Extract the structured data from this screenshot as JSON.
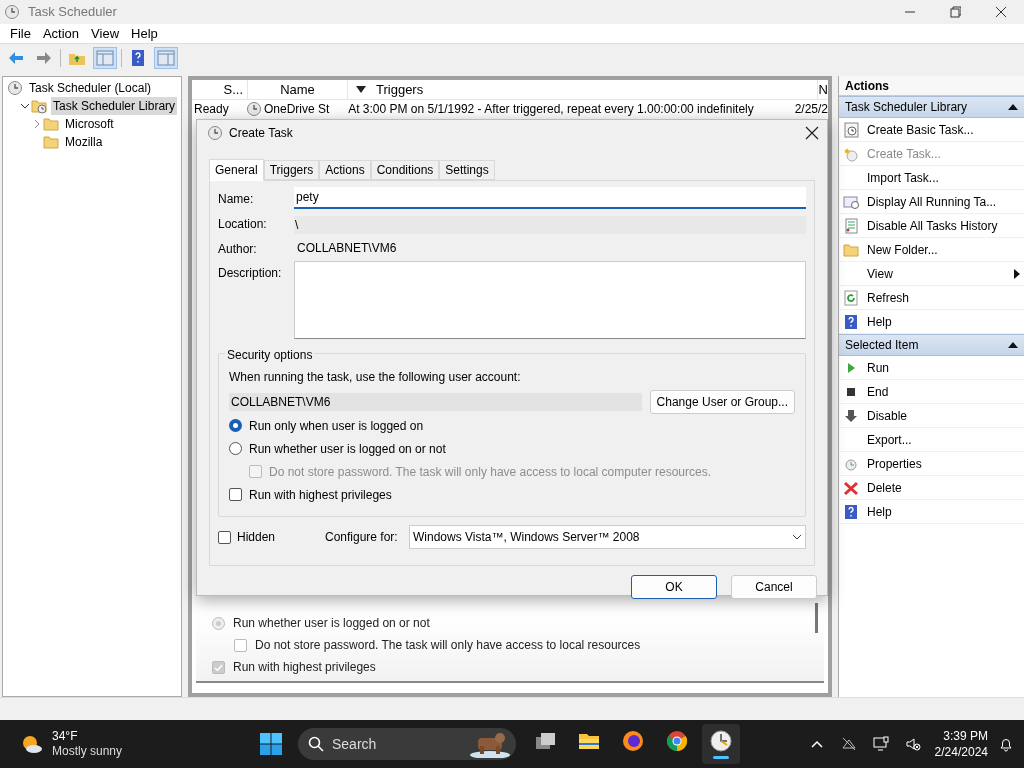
{
  "window": {
    "title": "Task Scheduler"
  },
  "menu": [
    "File",
    "Action",
    "View",
    "Help"
  ],
  "tree": [
    {
      "label": "Task Scheduler (Local)",
      "selected": false,
      "children": [
        {
          "label": "Task Scheduler Library",
          "selected": true,
          "expanded": true,
          "children": [
            {
              "label": "Microsoft",
              "selected": false,
              "expanded": false
            },
            {
              "label": "Mozilla",
              "selected": false
            }
          ]
        }
      ]
    }
  ],
  "task_list": {
    "columns": [
      "S...",
      "Name",
      "Triggers",
      "N"
    ],
    "rows": [
      [
        "Ready",
        "OneDrive St",
        "At 3:00 PM on 5/1/1992 - After triggered, repeat every 1.00:00:00 indefinitely",
        "2/25/2"
      ]
    ]
  },
  "background_properties": [
    {
      "kind": "radio",
      "label": "Run whether user is logged on or not",
      "checked": false
    },
    {
      "kind": "checkbox",
      "label": "Do not store password.  The task will only have access to local resources",
      "checked": false
    },
    {
      "kind": "checkbox",
      "label": "Run with highest privileges",
      "checked": true
    }
  ],
  "actions": {
    "title": "Actions",
    "sections": [
      {
        "title": "Task Scheduler Library",
        "items": [
          {
            "label": "Create Basic Task...",
            "disabled": false
          },
          {
            "label": "Create Task...",
            "disabled": true
          },
          {
            "label": "Import Task...",
            "disabled": false
          },
          {
            "label": "Display All Running Ta...",
            "disabled": false
          },
          {
            "label": "Disable All Tasks History",
            "disabled": false
          },
          {
            "label": "New Folder...",
            "disabled": false
          },
          {
            "label": "View",
            "disabled": false,
            "submenu": true
          },
          {
            "label": "Refresh",
            "disabled": false
          },
          {
            "label": "Help",
            "disabled": false
          }
        ]
      },
      {
        "title": "Selected Item",
        "items": [
          {
            "label": "Run",
            "disabled": false
          },
          {
            "label": "End",
            "disabled": false
          },
          {
            "label": "Disable",
            "disabled": false
          },
          {
            "label": "Export...",
            "disabled": false
          },
          {
            "label": "Properties",
            "disabled": false
          },
          {
            "label": "Delete",
            "disabled": false
          },
          {
            "label": "Help",
            "disabled": false
          }
        ]
      }
    ]
  },
  "dialog": {
    "title": "Create Task",
    "tabs": [
      {
        "label": "General",
        "selected": true
      },
      {
        "label": "Triggers",
        "selected": false
      },
      {
        "label": "Actions",
        "selected": false
      },
      {
        "label": "Conditions",
        "selected": false
      },
      {
        "label": "Settings",
        "selected": false
      }
    ],
    "name": {
      "label": "Name:",
      "value": "pety"
    },
    "location": {
      "label": "Location:",
      "value": "\\"
    },
    "author": {
      "label": "Author:",
      "value": "COLLABNET\\VM6"
    },
    "description": {
      "label": "Description:"
    },
    "security": {
      "title": "Security options",
      "prompt": "When running the task, use the following user account:",
      "account": "COLLABNET\\VM6",
      "change_button": "Change User or Group...",
      "options": [
        {
          "kind": "radio",
          "label": "Run only when user is logged on",
          "checked": true
        },
        {
          "kind": "radio",
          "label": "Run whether user is logged on or not",
          "checked": false
        },
        {
          "kind": "checkbox",
          "label": "Do not store password.  The task will only have access to local computer resources.",
          "checked": false,
          "disabled": true,
          "indent": true
        },
        {
          "kind": "checkbox",
          "label": "Run with highest privileges",
          "checked": false,
          "disabled": false
        }
      ]
    },
    "hidden": {
      "label": "Hidden",
      "checked": false
    },
    "configure": {
      "label": "Configure for:",
      "value": "Windows Vista™, Windows Server™ 2008"
    },
    "buttons": [
      "OK",
      "Cancel"
    ]
  },
  "taskbar": {
    "weather": {
      "temp": "34°F",
      "condition": "Mostly sunny"
    },
    "search": {
      "placeholder": "Search"
    },
    "apps": [
      {
        "kind": "taskview",
        "active": false
      },
      {
        "kind": "explorer",
        "active": false
      },
      {
        "kind": "firefox",
        "active": false
      },
      {
        "kind": "chrome",
        "active": false
      },
      {
        "kind": "scheduler",
        "active": true
      }
    ],
    "time": "3:39 PM",
    "date": "2/24/2024"
  }
}
